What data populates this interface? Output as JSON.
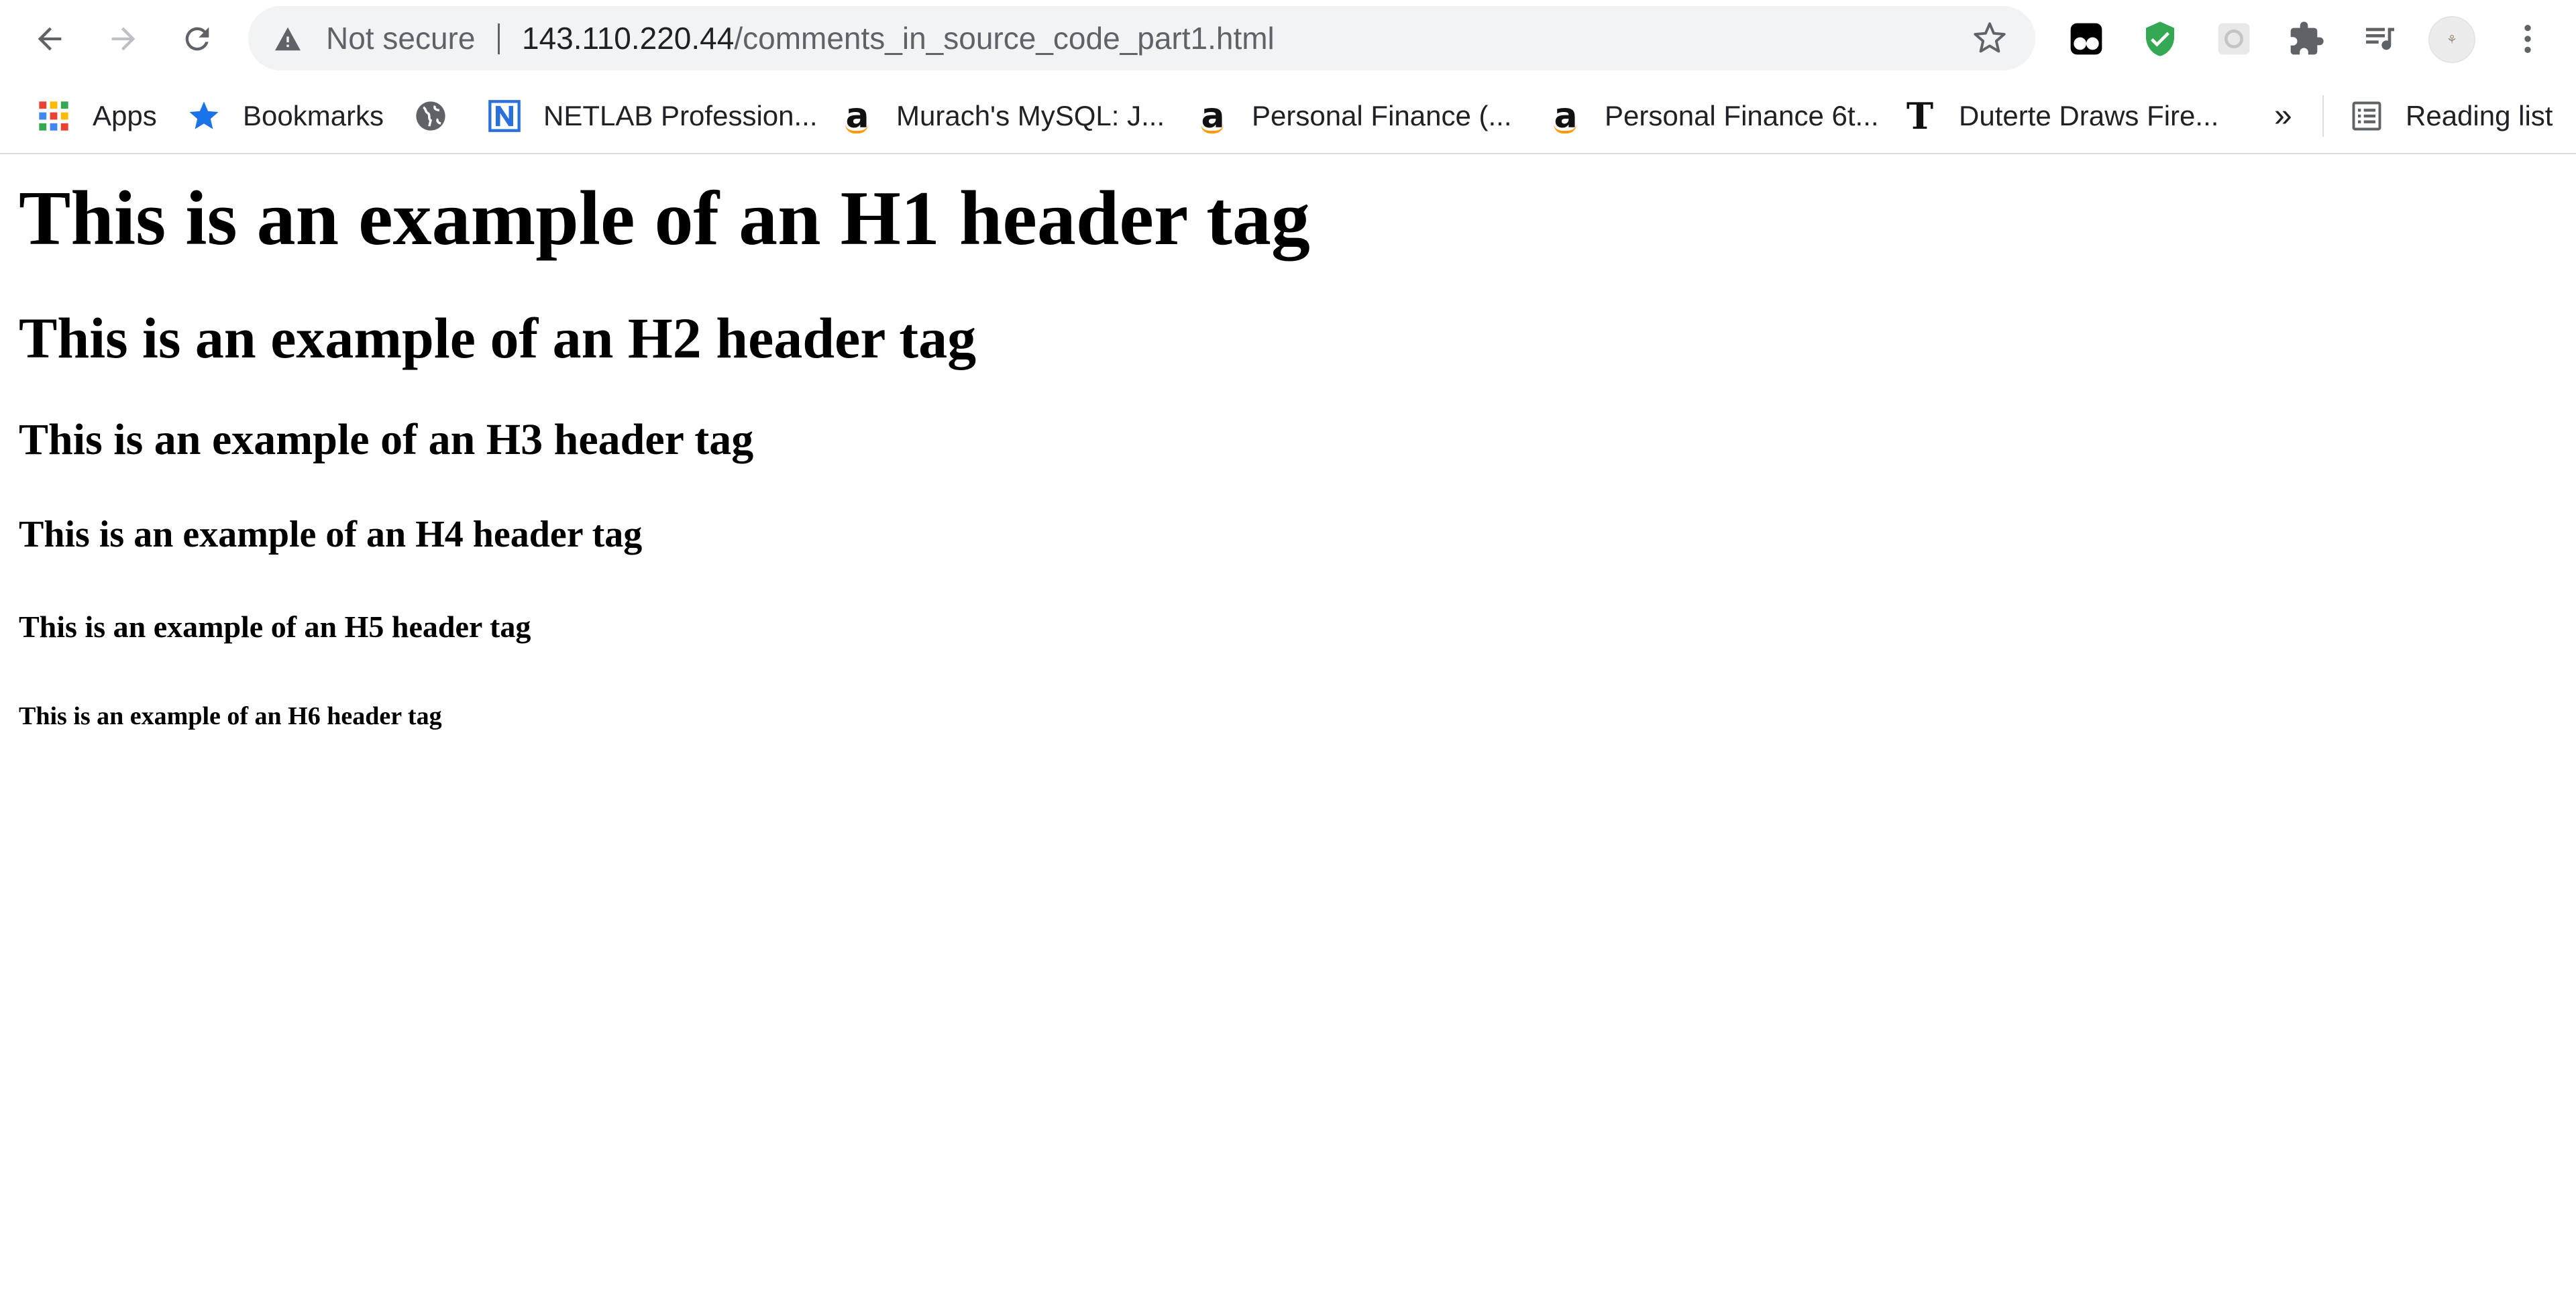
{
  "browser": {
    "security_label": "Not secure",
    "url_host": "143.110.220.44",
    "url_path": "/comments_in_source_code_part1.html"
  },
  "bookmarks_bar": {
    "items": [
      {
        "label": "Apps",
        "icon": "apps-grid-icon"
      },
      {
        "label": "Bookmarks",
        "icon": "star-icon"
      },
      {
        "label": "",
        "icon": "globe-icon"
      },
      {
        "label": "NETLAB Profession...",
        "icon": "netlab-icon"
      },
      {
        "label": "Murach's MySQL: J...",
        "icon": "amazon-icon"
      },
      {
        "label": "Personal Finance (...",
        "icon": "amazon-icon"
      },
      {
        "label": "Personal Finance 6t...",
        "icon": "amazon-icon"
      },
      {
        "label": "Duterte Draws Fire...",
        "icon": "nyt-icon"
      }
    ],
    "overflow_label": "»",
    "reading_list_label": "Reading list"
  },
  "page": {
    "h1": "This is an example of an H1 header tag",
    "h2": "This is an example of an H2 header tag",
    "h3": "This is an example of an H3 header tag",
    "h4": "This is an example of an H4 header tag",
    "h5": "This is an example of an H5 header tag",
    "h6": "This is an example of an H6 header tag"
  },
  "colors": {
    "chrome_text": "#5f6368",
    "omnibox_bg": "#f1f3f4",
    "shield_green": "#34a853",
    "bookmark_star": "#1a73e8"
  }
}
